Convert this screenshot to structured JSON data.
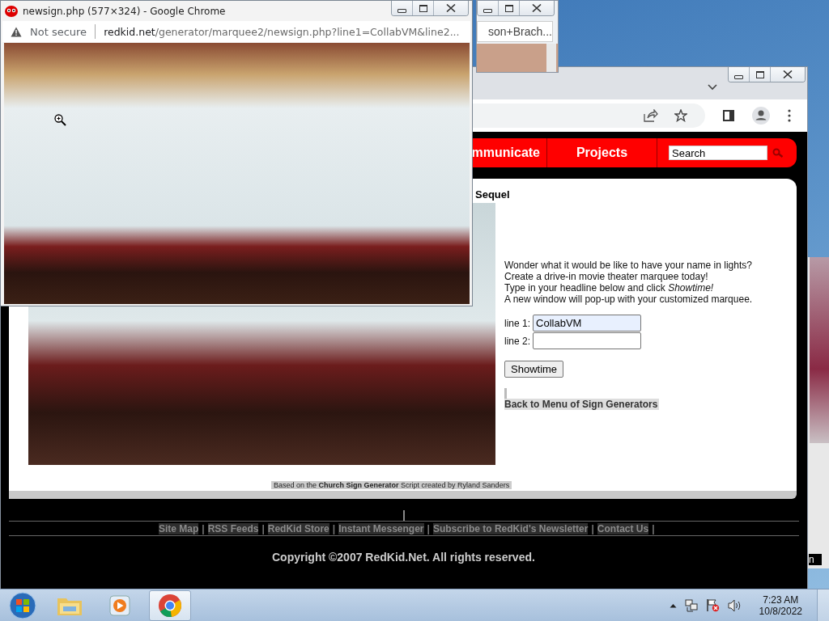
{
  "popup_window": {
    "title": "newsign.php (577×324) - Google Chrome",
    "security": "Not secure",
    "url_host": "redkid.net",
    "url_path": "/generator/marquee2/newsign.php?line1=CollabVM&line2..."
  },
  "back_window": {
    "url_tail": "son+Brach..."
  },
  "main_window": {
    "nav": [
      {
        "label": "mmunicate"
      },
      {
        "label": "Projects"
      }
    ],
    "search": {
      "value": "Search"
    },
    "heading": "Sequel",
    "intro_lines": [
      "Wonder what it would be like to have your name in lights?",
      "Create a drive-in movie theater marquee today!",
      "Type in your headline below and click *Showtime!*",
      "A new window will pop-up with your customized marquee."
    ],
    "fields": [
      {
        "label": "line 1:",
        "value": "CollabVM"
      },
      {
        "label": "line 2:"
      }
    ],
    "submit": "Showtime",
    "back_link": "Back to Menu of Sign Generators",
    "credits": "Based on the **Church Sign Generator** Script created by Ryland Sanders",
    "footer_links": [
      {
        "label": "Site Map",
        "separator": "|"
      },
      {
        "label": "RSS Feeds",
        "separator": "|"
      },
      {
        "label": "RedKid Store",
        "separator": "|"
      },
      {
        "label": "Instant Messenger",
        "separator": "|"
      },
      {
        "label": "Subscribe to RedKid's Newsletter",
        "separator": "|"
      },
      {
        "label": "Contact Us",
        "separator": "|"
      }
    ],
    "copyright": "Copyright ©2007 RedKid.Net. All rights reserved."
  },
  "side_window": {
    "text": "n"
  },
  "taskbar": {
    "items": [
      {
        "kind": "start",
        "selected": false
      },
      {
        "kind": "folder",
        "selected": false
      },
      {
        "kind": "media",
        "selected": false
      },
      {
        "kind": "chrome",
        "selected": true
      }
    ],
    "time": "7:23 AM",
    "date": "10/8/2022"
  }
}
